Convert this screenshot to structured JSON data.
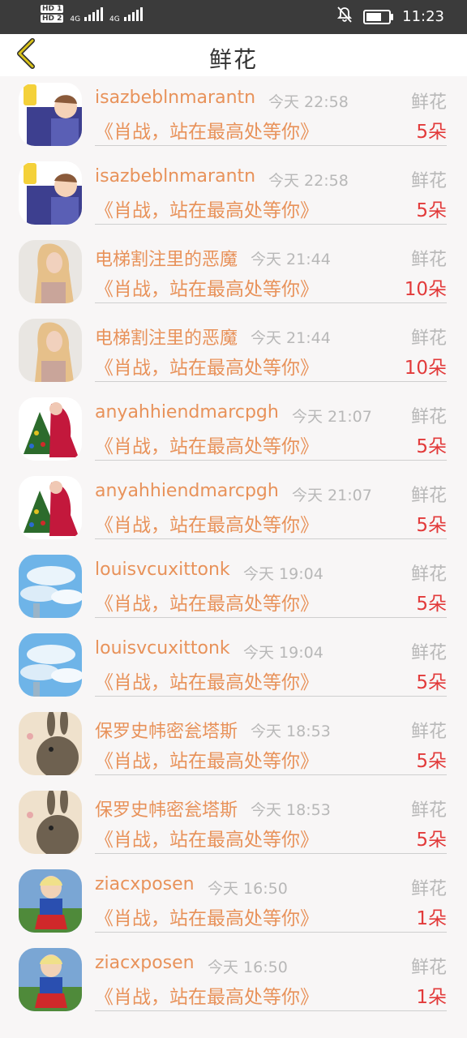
{
  "status_bar": {
    "hd1": "HD 1",
    "hd2": "HD 2",
    "net1": "4G",
    "net2": "4G",
    "time": "11:23"
  },
  "header": {
    "title": "鲜花"
  },
  "list": [
    {
      "name": "isazbeblnmarantn",
      "time": "今天 22:58",
      "type": "鲜花",
      "message": "《肖战，站在最高处等你》",
      "count": "5朵",
      "avatar": "cartoon-boy"
    },
    {
      "name": "isazbeblnmarantn",
      "time": "今天 22:58",
      "type": "鲜花",
      "message": "《肖战，站在最高处等你》",
      "count": "5朵",
      "avatar": "cartoon-boy"
    },
    {
      "name": "电梯割注里的恶魔",
      "time": "今天 21:44",
      "type": "鲜花",
      "message": "《肖战，站在最高处等你》",
      "count": "10朵",
      "avatar": "blonde-girl"
    },
    {
      "name": "电梯割注里的恶魔",
      "time": "今天 21:44",
      "type": "鲜花",
      "message": "《肖战，站在最高处等你》",
      "count": "10朵",
      "avatar": "blonde-girl"
    },
    {
      "name": "anyahhiendmarcpgh",
      "time": "今天 21:07",
      "type": "鲜花",
      "message": "《肖战，站在最高处等你》",
      "count": "5朵",
      "avatar": "christmas-tree"
    },
    {
      "name": "anyahhiendmarcpgh",
      "time": "今天 21:07",
      "type": "鲜花",
      "message": "《肖战，站在最高处等你》",
      "count": "5朵",
      "avatar": "christmas-tree"
    },
    {
      "name": "louisvcuxittonk",
      "time": "今天 19:04",
      "type": "鲜花",
      "message": "《肖战，站在最高处等你》",
      "count": "5朵",
      "avatar": "blue-sky"
    },
    {
      "name": "louisvcuxittonk",
      "time": "今天 19:04",
      "type": "鲜花",
      "message": "《肖战，站在最高处等你》",
      "count": "5朵",
      "avatar": "blue-sky"
    },
    {
      "name": "保罗史帏密瓮塔斯",
      "time": "今天 18:53",
      "type": "鲜花",
      "message": "《肖战，站在最高处等你》",
      "count": "5朵",
      "avatar": "rabbit"
    },
    {
      "name": "保罗史帏密瓮塔斯",
      "time": "今天 18:53",
      "type": "鲜花",
      "message": "《肖战，站在最高处等你》",
      "count": "5朵",
      "avatar": "rabbit"
    },
    {
      "name": "ziacxposen",
      "time": "今天 16:50",
      "type": "鲜花",
      "message": "《肖战，站在最高处等你》",
      "count": "1朵",
      "avatar": "little-girl"
    },
    {
      "name": "ziacxposen",
      "time": "今天 16:50",
      "type": "鲜花",
      "message": "《肖战，站在最高处等你》",
      "count": "1朵",
      "avatar": "little-girl"
    }
  ]
}
